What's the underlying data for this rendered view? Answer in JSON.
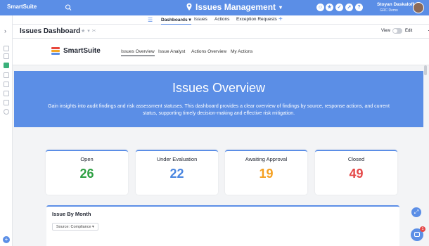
{
  "topbar": {
    "brand": "SmartSuite",
    "workspace_title": "Issues Management",
    "user_name": "Stoyan Daskaloff",
    "user_org": "GRC Demo",
    "accent": "#5b8ee6"
  },
  "nav": {
    "tabs": [
      {
        "label": "Dashboards",
        "active": true
      },
      {
        "label": "Issues",
        "active": false
      },
      {
        "label": "Actions",
        "active": false
      },
      {
        "label": "Exception Requests",
        "active": false
      }
    ]
  },
  "titlebar": {
    "title": "Issues Dashboard",
    "view_label": "View",
    "edit_label": "Edit"
  },
  "dashboard": {
    "logo_text": "SmartSuite",
    "tabs": [
      {
        "label": "Issues Overview",
        "active": true
      },
      {
        "label": "Issue Analyst",
        "active": false
      },
      {
        "label": "Actions Overview",
        "active": false
      },
      {
        "label": "My Actions",
        "active": false
      }
    ]
  },
  "hero": {
    "title": "Issues Overview",
    "description": "Gain insights into audit findings and risk assessment statuses. This dashboard provides a clear overview of findings by source, response actions, and current status, supporting timely decision-making and effective risk mitigation."
  },
  "stats": [
    {
      "label": "Open",
      "value": "26",
      "color": "#2ea043"
    },
    {
      "label": "Under Evaluation",
      "value": "22",
      "color": "#4a86e0"
    },
    {
      "label": "Awaiting Approval",
      "value": "19",
      "color": "#f5a020"
    },
    {
      "label": "Closed",
      "value": "49",
      "color": "#e54848"
    }
  ],
  "panel": {
    "title": "Issue By Month",
    "filter": "Source: Compliance"
  },
  "notifications": {
    "badge_count": "1"
  }
}
